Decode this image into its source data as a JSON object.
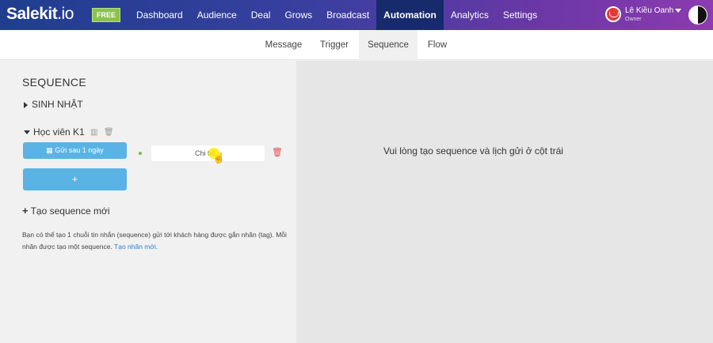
{
  "app": {
    "logo_main": "Salekit",
    "logo_suffix": ".io",
    "plan_badge": "FREE"
  },
  "nav": {
    "items": [
      {
        "label": "Dashboard"
      },
      {
        "label": "Audience"
      },
      {
        "label": "Deal"
      },
      {
        "label": "Grows"
      },
      {
        "label": "Broadcast"
      },
      {
        "label": "Automation",
        "active": true
      },
      {
        "label": "Analytics"
      },
      {
        "label": "Settings"
      }
    ]
  },
  "user": {
    "name": "Lê Kiều Oanh",
    "role": "Owner"
  },
  "subnav": {
    "tabs": [
      {
        "label": "Message"
      },
      {
        "label": "Trigger"
      },
      {
        "label": "Sequence",
        "active": true
      },
      {
        "label": "Flow"
      }
    ]
  },
  "sidebar": {
    "title": "SEQUENCE",
    "groups": [
      {
        "label": "SINH NHẬT",
        "expanded": false
      },
      {
        "label": "Học viên K1",
        "expanded": true
      }
    ],
    "send_after_button": "Gửi sau 1 ngày",
    "add_button": "+",
    "detail_label": "Chi tiế...",
    "new_sequence": "Tạo sequence mới",
    "help_text": "Bạn có thể tạo 1 chuỗi tin nhắn (sequence) gửi tới khách hàng được gắn nhãn (tag). Mỗi nhãn được tạo một sequence.",
    "help_link": "Tạo nhãn mới."
  },
  "main": {
    "empty_message": "Vui lòng tạo sequence và lịch gửi ở cột trái"
  },
  "colors": {
    "accent_blue": "#59b3e4",
    "free_badge": "#8bc34a",
    "nav_active": "#172a6b",
    "delete_red": "#e05050"
  }
}
